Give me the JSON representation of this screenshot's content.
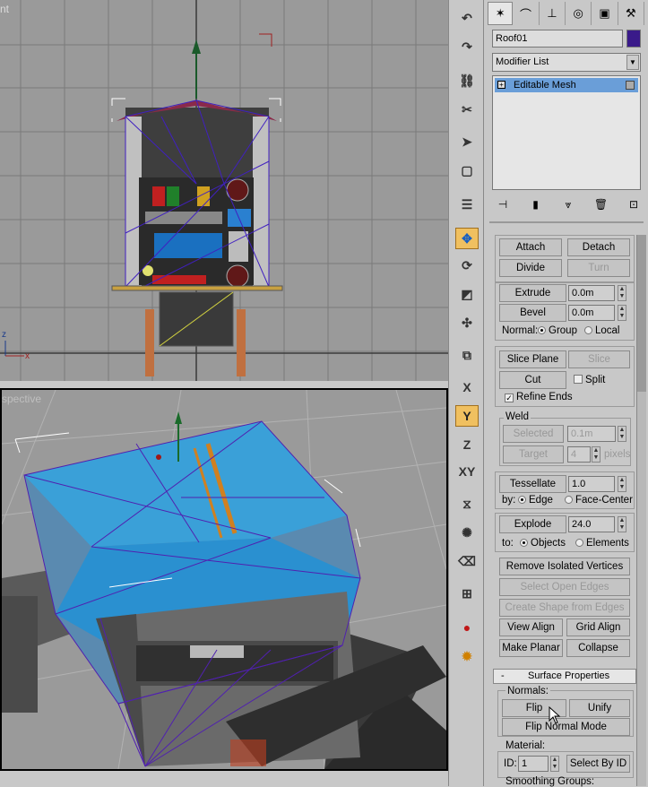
{
  "viewports": {
    "top": {
      "label": "nt"
    },
    "perspective": {
      "label": "spective"
    }
  },
  "toolbar": {
    "items": [
      {
        "name": "undo-icon",
        "glyph": "↶"
      },
      {
        "name": "redo-icon",
        "glyph": "↷"
      },
      {
        "name": "link-icon",
        "glyph": "⛓"
      },
      {
        "name": "unlink-icon",
        "glyph": "✂"
      },
      {
        "name": "select-icon",
        "glyph": "➤"
      },
      {
        "name": "select-region-icon",
        "glyph": "▢"
      },
      {
        "name": "select-by-name-icon",
        "glyph": "☰"
      },
      {
        "name": "move-icon",
        "glyph": "✥"
      },
      {
        "name": "rotate-icon",
        "glyph": "⟳"
      },
      {
        "name": "scale-icon",
        "glyph": "◩"
      },
      {
        "name": "pivot-icon",
        "glyph": "✣"
      },
      {
        "name": "snap-icon",
        "glyph": "⧉"
      },
      {
        "name": "axis-x-icon",
        "glyph": "X"
      },
      {
        "name": "axis-y-icon",
        "glyph": "Y"
      },
      {
        "name": "axis-z-icon",
        "glyph": "Z"
      },
      {
        "name": "axis-xy-icon",
        "glyph": "XY"
      },
      {
        "name": "mirror-icon",
        "glyph": "⧖"
      },
      {
        "name": "array-icon",
        "glyph": "✺"
      },
      {
        "name": "eraser-icon",
        "glyph": "⌫"
      },
      {
        "name": "align-icon",
        "glyph": "⊞"
      },
      {
        "name": "material-editor-icon",
        "glyph": "●"
      },
      {
        "name": "render-icon",
        "glyph": "✹"
      }
    ]
  },
  "panel": {
    "tabs": [
      {
        "name": "create-tab-icon",
        "glyph": "✶"
      },
      {
        "name": "modify-tab-icon",
        "glyph": "⌒"
      },
      {
        "name": "hierarchy-tab-icon",
        "glyph": "⊥"
      },
      {
        "name": "motion-tab-icon",
        "glyph": "◎"
      },
      {
        "name": "display-tab-icon",
        "glyph": "▣"
      },
      {
        "name": "utilities-tab-icon",
        "glyph": "⚒"
      }
    ],
    "object_name": "Roof01",
    "object_color": "#3a1a8a",
    "modifier_list": "Modifier List",
    "modifier_stack": [
      "Editable Mesh"
    ],
    "stack_buttons": [
      {
        "name": "pin-stack-icon",
        "glyph": "⊣"
      },
      {
        "name": "show-end-result-icon",
        "glyph": "▮"
      },
      {
        "name": "make-unique-icon",
        "glyph": "⩔"
      },
      {
        "name": "remove-modifier-icon",
        "glyph": "🗑"
      },
      {
        "name": "configure-sets-icon",
        "glyph": "⊡"
      }
    ],
    "edit_geometry": {
      "attach": "Attach",
      "detach": "Detach",
      "divide": "Divide",
      "turn": "Turn",
      "extrude": "Extrude",
      "extrude_value": "0.0m",
      "bevel": "Bevel",
      "bevel_value": "0.0m",
      "normal_label": "Normal:",
      "normal_group": "Group",
      "normal_local": "Local",
      "slice_plane": "Slice Plane",
      "slice": "Slice",
      "cut": "Cut",
      "split": "Split",
      "refine_ends": "Refine Ends",
      "weld_label": "Weld",
      "weld_selected": "Selected",
      "weld_selected_value": "0.1m",
      "weld_target": "Target",
      "weld_target_value": "4",
      "pixels": "pixels",
      "tessellate": "Tessellate",
      "tessellate_value": "1.0",
      "by_label": "by:",
      "by_edge": "Edge",
      "by_face_center": "Face-Center",
      "explode": "Explode",
      "explode_value": "24.0",
      "to_label": "to:",
      "to_objects": "Objects",
      "to_elements": "Elements",
      "remove_isolated": "Remove Isolated Vertices",
      "select_open_edges": "Select Open Edges",
      "create_shape": "Create Shape from Edges",
      "view_align": "View Align",
      "grid_align": "Grid Align",
      "make_planar": "Make Planar",
      "collapse": "Collapse"
    },
    "surface": {
      "collapse_sign": "-",
      "title": "Surface Properties",
      "normals_label": "Normals:",
      "flip": "Flip",
      "unify": "Unify",
      "flip_normal_mode": "Flip Normal Mode",
      "material_label": "Material:",
      "id_label": "ID:",
      "id_value": "1",
      "select_by_id": "Select By ID",
      "smoothing_groups": "Smoothing Groups:"
    }
  }
}
